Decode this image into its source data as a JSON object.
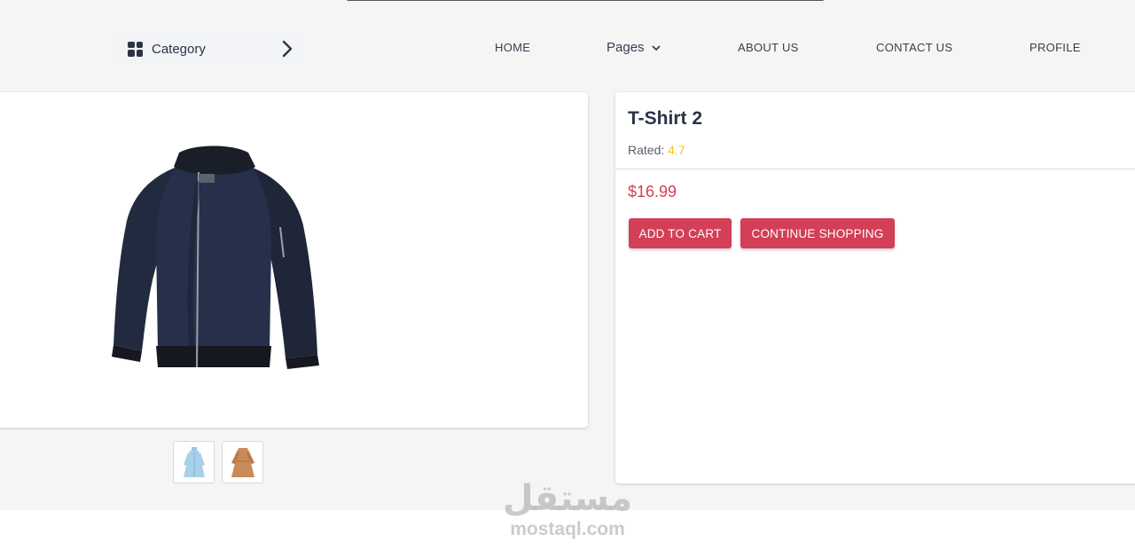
{
  "navbar": {
    "category_label": "Category",
    "items": {
      "home": "HOME",
      "pages": "Pages",
      "about": "ABOUT US",
      "contact": "CONTACT US",
      "profile": "PROFILE"
    }
  },
  "product": {
    "title": "T-Shirt 2",
    "rated_label": "Rated:",
    "rating": "4.7",
    "price": "$16.99",
    "main_image": "navy-bomber-jacket",
    "thumbnails": [
      "light-blue-dress",
      "tan-dress"
    ]
  },
  "actions": {
    "add_to_cart": "ADD TO CART",
    "continue_shopping": "CONTINUE SHOPPING"
  },
  "watermark": {
    "arabic": "مستقل",
    "latin": "mostaql.com"
  },
  "colors": {
    "accent": "#d23f57",
    "rating": "#f5c518",
    "text": "#2b3445",
    "background": "#f5f5f5"
  }
}
